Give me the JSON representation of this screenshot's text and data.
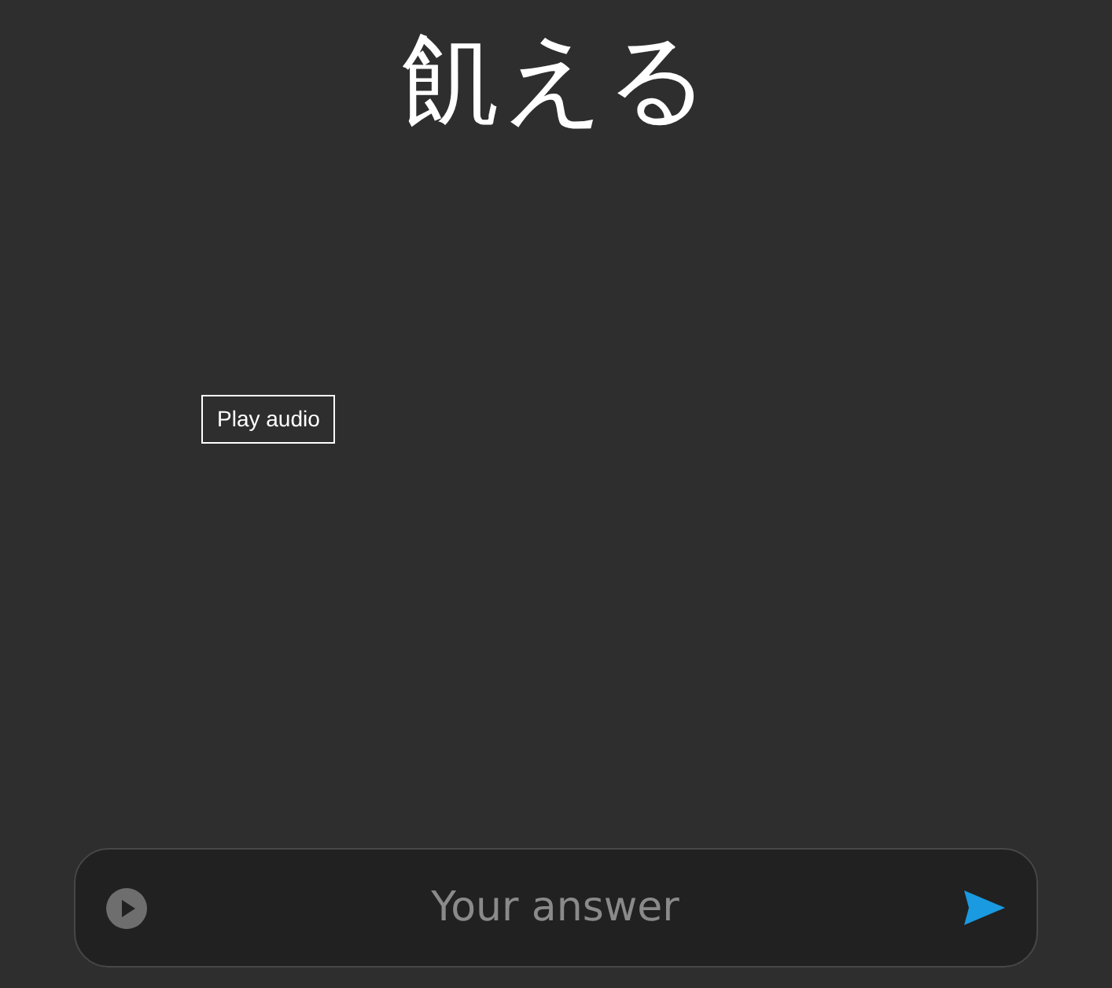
{
  "title": "飢える",
  "tooltip": "Play audio",
  "answer": {
    "placeholder": "Your answer"
  }
}
